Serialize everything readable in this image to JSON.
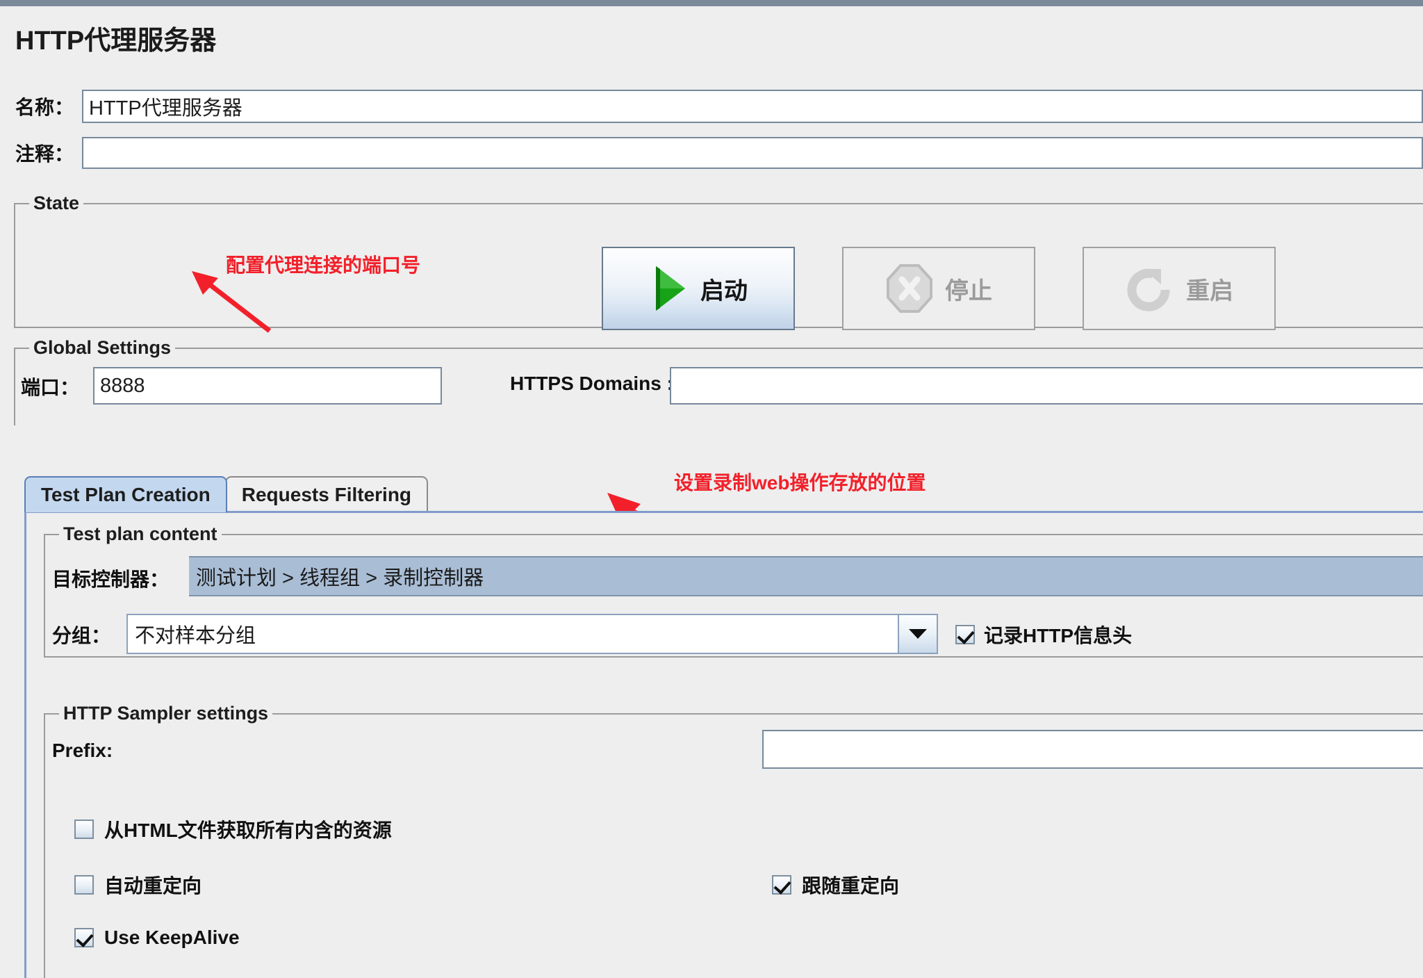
{
  "window": {
    "title": "HTTP代理服务器"
  },
  "fields": {
    "name_label": "名称：",
    "name_value": "HTTP代理服务器",
    "comment_label": "注释：",
    "comment_value": ""
  },
  "state": {
    "group_title": "State",
    "annotation": "配置代理连接的端口号",
    "buttons": [
      {
        "label": "启动",
        "icon": "play-icon",
        "enabled": true
      },
      {
        "label": "停止",
        "icon": "stop-octagon-icon",
        "enabled": false
      },
      {
        "label": "重启",
        "icon": "restart-arrow-icon",
        "enabled": false
      }
    ]
  },
  "global_settings": {
    "group_title": "Global Settings",
    "port_label": "端口：",
    "port_value": "8888",
    "https_domains_label": "HTTPS Domains :",
    "https_domains_value": ""
  },
  "tabs": [
    {
      "label": "Test Plan Creation",
      "active": true
    },
    {
      "label": "Requests Filtering",
      "active": false
    }
  ],
  "tab_annotation": "设置录制web操作存放的位置",
  "test_plan_content": {
    "group_title": "Test plan content",
    "target_controller_label": "目标控制器：",
    "target_controller_value": "测试计划 > 线程组 > 录制控制器",
    "grouping_label": "分组：",
    "grouping_value": "不对样本分组",
    "http_headers_checkbox": {
      "label": "记录HTTP信息头",
      "checked": true
    }
  },
  "http_sampler_settings": {
    "group_title": "HTTP Sampler settings",
    "prefix_label": "Prefix:",
    "prefix_value": "",
    "checkboxes": [
      {
        "label": "从HTML文件获取所有内含的资源",
        "checked": false
      },
      {
        "label": "自动重定向",
        "checked": false
      },
      {
        "label": "Use KeepAlive",
        "checked": true
      },
      {
        "label": "跟随重定向",
        "checked": true
      }
    ]
  },
  "colors": {
    "titlebar": "#7b8a99",
    "background": "#eeeeee",
    "annotation_red": "#f2202a",
    "selected_blue": "#a9bdd5",
    "active_tab_blue": "#c3d8ef",
    "field_border": "#76899c",
    "start_green": "#27a028"
  }
}
